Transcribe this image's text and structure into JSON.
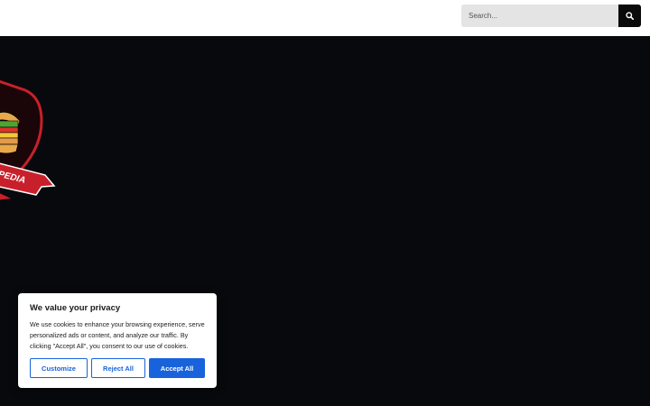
{
  "header": {
    "search": {
      "placeholder": "Search...",
      "icon": "search-icon"
    }
  },
  "logo": {
    "text": "PEDIA"
  },
  "cookie_banner": {
    "title": "We value your privacy",
    "body": "We use cookies to enhance your browsing experience, serve personalized ads or content, and analyze our traffic. By clicking \"Accept All\", you consent to our use of cookies.",
    "customize_label": "Customize",
    "reject_label": "Reject All",
    "accept_label": "Accept All"
  },
  "colors": {
    "page_background": "#08090c",
    "accent": "#1863dc",
    "logo_red": "#c8202b"
  }
}
